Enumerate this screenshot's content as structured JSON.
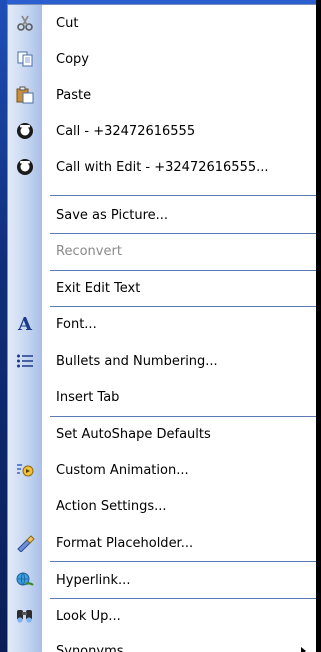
{
  "menu": {
    "items": [
      {
        "label": "Cut",
        "icon": "scissors-icon"
      },
      {
        "label": "Copy",
        "icon": "copy-icon"
      },
      {
        "label": "Paste",
        "icon": "paste-icon"
      },
      {
        "label": "Call - +32472616555",
        "icon": "phone-icon"
      },
      {
        "label": "Call with Edit - +32472616555...",
        "icon": "phone-icon"
      },
      {
        "label": "Save as Picture...",
        "icon": ""
      },
      {
        "label": "Reconvert",
        "icon": "",
        "disabled": true
      },
      {
        "label": "Exit Edit Text",
        "icon": ""
      },
      {
        "label": "Font...",
        "icon": "font-icon"
      },
      {
        "label": "Bullets and Numbering...",
        "icon": "bullets-icon"
      },
      {
        "label": "Insert Tab",
        "icon": ""
      },
      {
        "label": "Set AutoShape Defaults",
        "icon": ""
      },
      {
        "label": "Custom Animation...",
        "icon": "animation-icon"
      },
      {
        "label": "Action Settings...",
        "icon": ""
      },
      {
        "label": "Format Placeholder...",
        "icon": "format-icon"
      },
      {
        "label": "Hyperlink...",
        "icon": "hyperlink-icon"
      },
      {
        "label": "Look Up...",
        "icon": "lookup-icon"
      },
      {
        "label": "Synonyms",
        "icon": "",
        "submenu": true
      }
    ]
  },
  "colors": {
    "gutter": "#c6d6f1",
    "separator": "#5b78b7",
    "disabled_text": "#8a8a8a"
  }
}
